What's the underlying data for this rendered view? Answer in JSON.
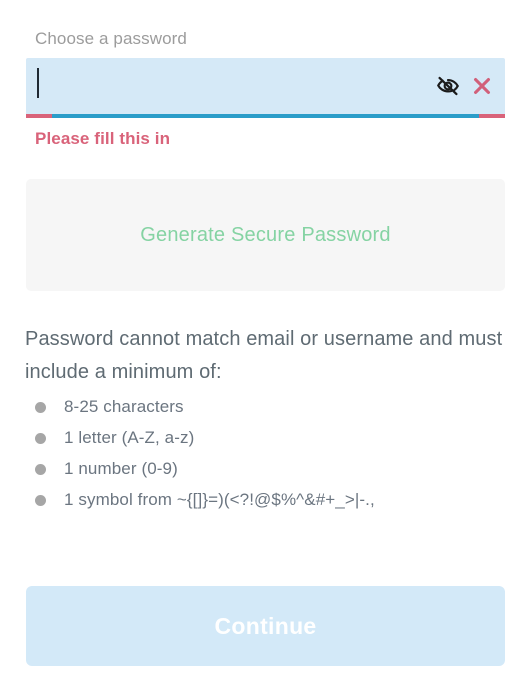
{
  "form": {
    "label": "Choose a password",
    "input": {
      "value": "",
      "placeholder": "",
      "type": "password"
    },
    "toggle_visibility_icon": "eye-slash-icon",
    "clear_icon": "close-x-icon",
    "error_message": "Please fill this in",
    "underline": {
      "base_color": "#d9637a",
      "progress_color": "#2b9dc9"
    },
    "field_background": "#d5e9f7"
  },
  "generate": {
    "label": "Generate Secure Password",
    "text_color": "#85d3a3",
    "background": "#f6f6f6"
  },
  "requirements": {
    "heading": "Password cannot match email or username and must include a minimum of:",
    "items": [
      "8-25 characters",
      "1 letter (A-Z, a-z)",
      "1 number (0-9)",
      "1 symbol from ~{[]}=)(<?!@$%^&#+_>|-.,"
    ]
  },
  "submit": {
    "label": "Continue",
    "background": "#d3e9f8",
    "text_color": "#ffffff",
    "disabled": true
  }
}
